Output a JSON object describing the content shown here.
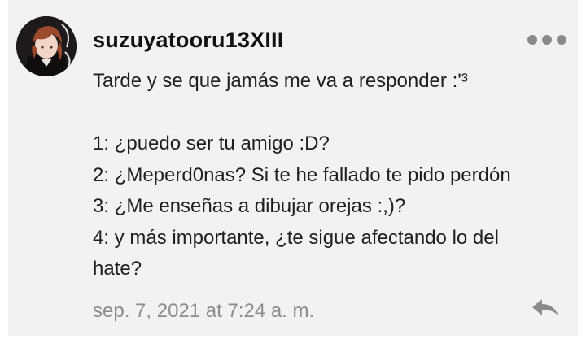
{
  "comment": {
    "username": "suzuyatooru13XIII",
    "message_lines": [
      "Tarde y se que jamás me va a responder :'³",
      "",
      "1: ¿puedo ser tu amigo :D?",
      "2: ¿Meperd0nas? Si te he fallado te pido perdón",
      "3: ¿Me enseñas a dibujar orejas :,)?",
      "4: y más importante, ¿te sigue afectando lo del",
      "hate?"
    ],
    "timestamp": "sep. 7, 2021 at 7:24 a. m."
  },
  "icons": {
    "more": "more-horizontal-icon",
    "reply": "reply-arrow-icon"
  },
  "colors": {
    "background": "#f2f2f2",
    "text": "#1f1f1f",
    "muted": "#8c8c8c",
    "icon": "#8a8a8a"
  }
}
